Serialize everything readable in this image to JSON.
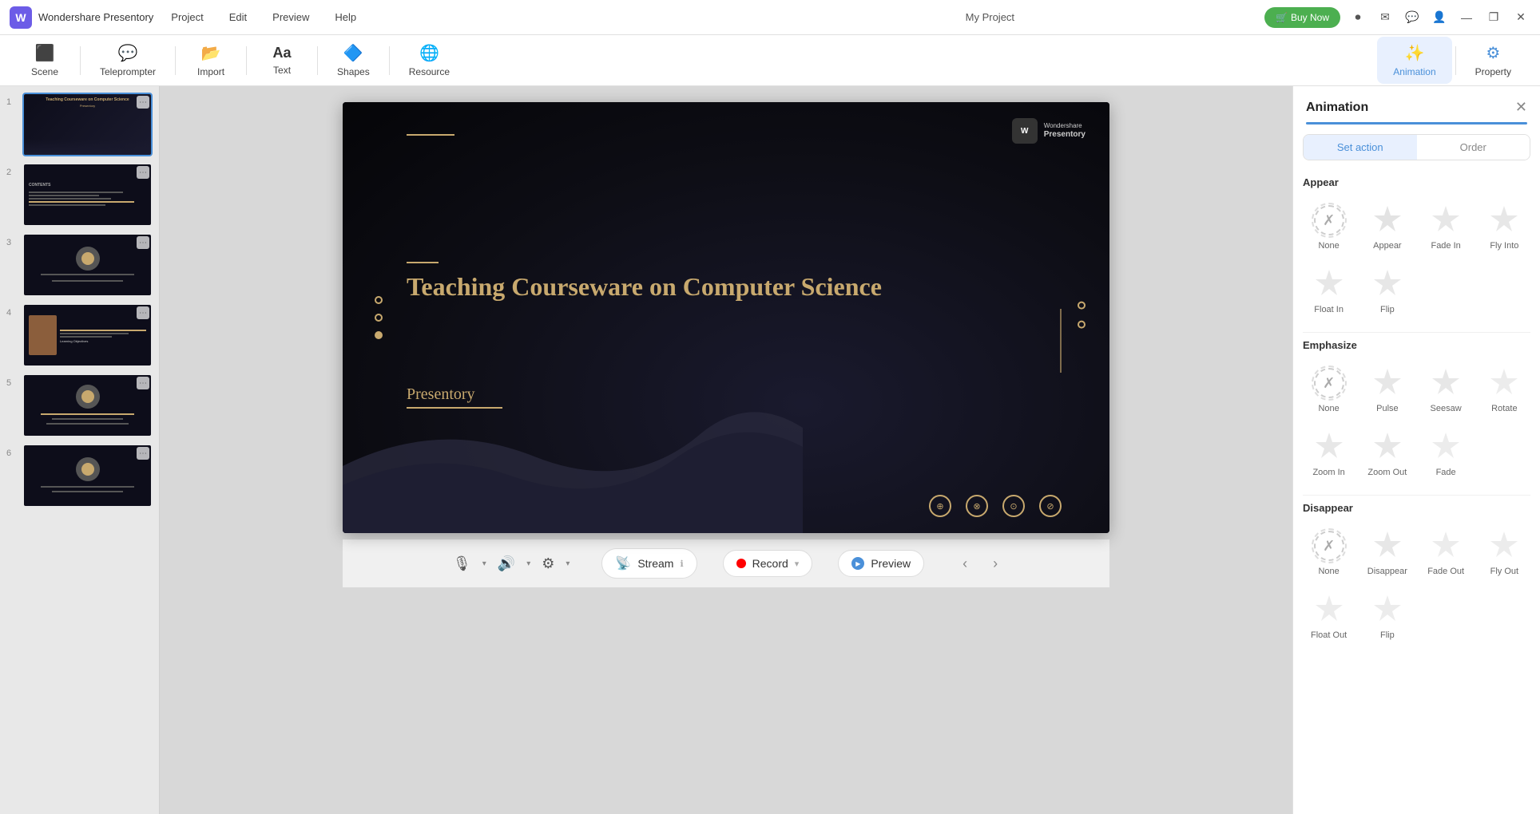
{
  "app": {
    "name": "Wondershare Presentory",
    "project_name": "My Project"
  },
  "titlebar": {
    "menus": [
      "Project",
      "Edit",
      "Preview",
      "Help"
    ],
    "buy_now": "Buy Now",
    "win_minimize": "—",
    "win_maximize": "❐",
    "win_close": "✕"
  },
  "toolbar": {
    "items": [
      {
        "id": "scene",
        "label": "Scene",
        "icon": "🎬"
      },
      {
        "id": "teleprompter",
        "label": "Teleprompter",
        "icon": "💬"
      },
      {
        "id": "import",
        "label": "Import",
        "icon": "📂"
      },
      {
        "id": "text",
        "label": "Text",
        "icon": "Aa"
      },
      {
        "id": "shapes",
        "label": "Shapes",
        "icon": "🔷"
      },
      {
        "id": "resource",
        "label": "Resource",
        "icon": "🌐"
      },
      {
        "id": "animation",
        "label": "Animation",
        "icon": "✨",
        "active": true
      },
      {
        "id": "property",
        "label": "Property",
        "icon": "⚙"
      }
    ]
  },
  "slides": [
    {
      "number": "1",
      "active": true
    },
    {
      "number": "2"
    },
    {
      "number": "3"
    },
    {
      "number": "4"
    },
    {
      "number": "5"
    },
    {
      "number": "6"
    }
  ],
  "canvas": {
    "title": "Teaching Courseware on Computer Science",
    "subtitle": "Presentory",
    "logo_text": "Wondershare\nPresentory"
  },
  "bottom_toolbar": {
    "mic_label": "🎙",
    "vol_label": "🔊",
    "settings_label": "⚙",
    "stream_label": "Stream",
    "record_label": "Record",
    "preview_label": "Preview",
    "info_icon": "ℹ",
    "dropdown_arrow": "▾",
    "nav_prev": "‹",
    "nav_next": "›"
  },
  "animation_panel": {
    "title": "Animation",
    "close": "✕",
    "tabs": [
      {
        "id": "set-action",
        "label": "Set action",
        "active": true
      },
      {
        "id": "order",
        "label": "Order"
      }
    ],
    "sections": {
      "appear": {
        "title": "Appear",
        "items": [
          {
            "id": "none",
            "label": "None",
            "type": "none"
          },
          {
            "id": "appear",
            "label": "Appear",
            "type": "star"
          },
          {
            "id": "fade-in",
            "label": "Fade In",
            "type": "star"
          },
          {
            "id": "fly-into",
            "label": "Fly Into",
            "type": "star"
          },
          {
            "id": "float-in",
            "label": "Float In",
            "type": "star"
          },
          {
            "id": "flip",
            "label": "Flip",
            "type": "star"
          }
        ]
      },
      "emphasize": {
        "title": "Emphasize",
        "items": [
          {
            "id": "none",
            "label": "None",
            "type": "none"
          },
          {
            "id": "pulse",
            "label": "Pulse",
            "type": "star"
          },
          {
            "id": "seesaw",
            "label": "Seesaw",
            "type": "star"
          },
          {
            "id": "rotate",
            "label": "Rotate",
            "type": "star"
          },
          {
            "id": "zoom-in",
            "label": "Zoom In",
            "type": "star"
          },
          {
            "id": "zoom-out",
            "label": "Zoom Out",
            "type": "star"
          },
          {
            "id": "fade",
            "label": "Fade",
            "type": "star"
          }
        ]
      },
      "disappear": {
        "title": "Disappear",
        "items": [
          {
            "id": "none",
            "label": "None",
            "type": "none"
          },
          {
            "id": "disappear",
            "label": "Disappear",
            "type": "star"
          },
          {
            "id": "fade-out",
            "label": "Fade Out",
            "type": "star"
          },
          {
            "id": "fly-out",
            "label": "Fly Out",
            "type": "star"
          },
          {
            "id": "float-out",
            "label": "Float Out",
            "type": "star"
          },
          {
            "id": "flip2",
            "label": "Flip",
            "type": "star"
          }
        ]
      }
    }
  }
}
